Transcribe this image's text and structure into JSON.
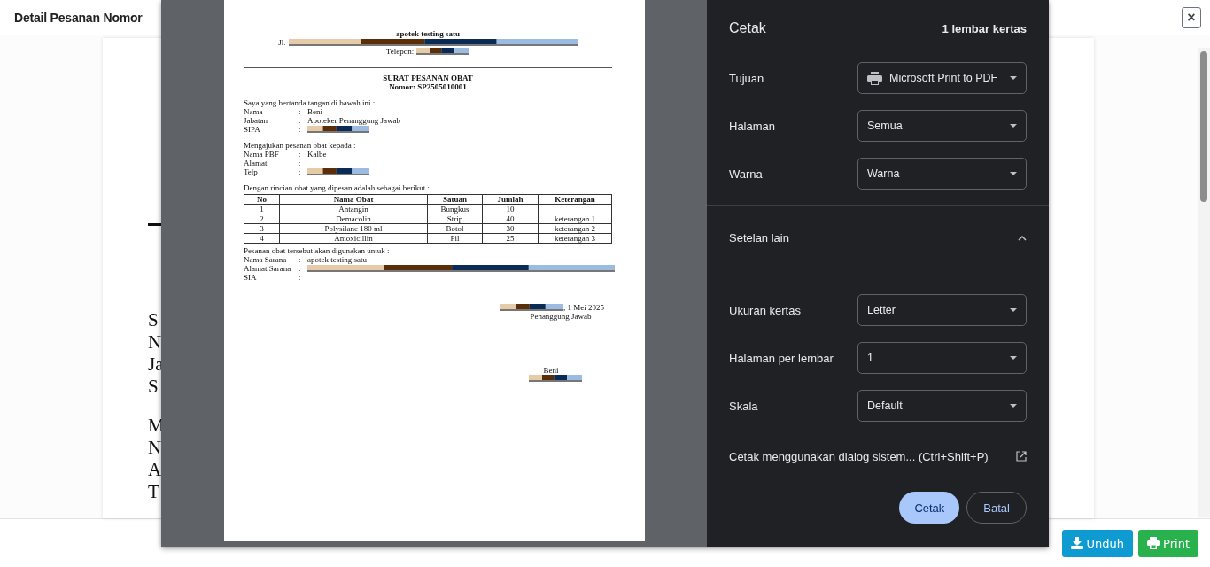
{
  "page": {
    "title": "Detail Pesanan Nomor",
    "close": "×"
  },
  "background_document": {
    "lines": [
      "S",
      "N",
      "Ja",
      "S",
      "M",
      "N",
      "A",
      "T"
    ]
  },
  "footer_buttons": [
    {
      "label": "Unduh",
      "kind": "download"
    },
    {
      "label": "Print",
      "kind": "print"
    }
  ],
  "print_preview": {
    "header": {
      "name": "apotek testing satu",
      "address_label": "Jl.",
      "phone_label": "Telepon:"
    },
    "title": "SURAT PESANAN OBAT",
    "number": "Nomor: SP2505010001",
    "intro": "Saya yang bertanda tangan di bawah ini :",
    "signer_fields": [
      {
        "label": "Nama",
        "sep": ":",
        "value": "Beni",
        "redacted": false
      },
      {
        "label": "Jabatan",
        "sep": ":",
        "value": "Apoteker Penanggung Jawab",
        "redacted": false
      },
      {
        "label": "SIPA",
        "sep": ":",
        "redacted": true
      }
    ],
    "recipient_intro": "Mengajukan pesanan obat kepada :",
    "recipient_fields": [
      {
        "label": "Nama PBF",
        "sep": ":",
        "value": "Kalbe",
        "redacted": false
      },
      {
        "label": "Alamat",
        "sep": ":",
        "redacted": false
      },
      {
        "label": "Telp",
        "sep": ":",
        "redacted": true
      }
    ],
    "table_intro": "Dengan rincian obat yang dipesan adalah sebagai berikut :",
    "table": {
      "columns": [
        "No",
        "Nama Obat",
        "Satuan",
        "Jumlah",
        "Keterangan"
      ],
      "rows": [
        [
          "1",
          "Antangin",
          "Bungkus",
          "10",
          ""
        ],
        [
          "2",
          "Demacolin",
          "Strip",
          "40",
          "keterangan 1"
        ],
        [
          "3",
          "Polysilane 180 ml",
          "Botol",
          "30",
          "keterangan 2"
        ],
        [
          "4",
          "Amoxicillin",
          "Pil",
          "25",
          "keterangan 3"
        ]
      ]
    },
    "usage_intro": "Pesanan obat  tersebut akan digunakan untuk :",
    "usage_fields": [
      {
        "label": "Nama Sarana",
        "sep": ":",
        "value": "apotek testing satu",
        "redacted": false
      },
      {
        "label": "Alamat Sarana",
        "sep": ":",
        "redacted": true
      },
      {
        "label": "SIA",
        "sep": ":",
        "redacted": false
      }
    ],
    "date": ", 1 Mei 2025",
    "signer_role": "Penanggung Jawab",
    "signer_name": "Beni"
  },
  "print_settings": {
    "title": "Cetak",
    "sheets": "1 lembar kertas",
    "settings": [
      {
        "label": "Tujuan",
        "value": "Microsoft Print to PDF",
        "kind": "printer"
      },
      {
        "label": "Halaman",
        "value": "Semua",
        "kind": "select"
      },
      {
        "label": "Warna",
        "value": "Warna",
        "kind": "select"
      }
    ],
    "more": {
      "label": "Setelan lain",
      "expanded": true
    },
    "more_settings": [
      {
        "label": "Ukuran kertas",
        "value": "Letter",
        "kind": "select"
      },
      {
        "label": "Halaman per lembar",
        "value": "1",
        "kind": "select"
      },
      {
        "label": "Skala",
        "value": "Default",
        "kind": "select"
      }
    ],
    "system_dialog": "Cetak menggunakan dialog sistem... (Ctrl+Shift+P)",
    "buttons": [
      {
        "label": "Cetak",
        "kind": "primary"
      },
      {
        "label": "Batal",
        "kind": "secondary"
      }
    ]
  }
}
